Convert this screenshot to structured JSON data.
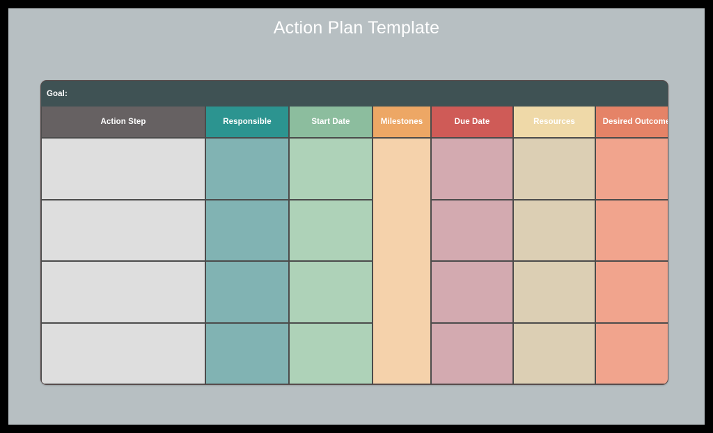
{
  "page": {
    "title": "Action Plan Template",
    "background_color": "#b7bfc2",
    "frame_color": "#000000"
  },
  "table": {
    "goal_label": "Goal:",
    "goal_bar_color": "#3f5254",
    "border_color": "#5a4c4c",
    "row_count": 4,
    "columns": [
      {
        "key": "action_step",
        "header": "Action Step",
        "header_color": "#666162",
        "body_color": "#dedede",
        "merged": false
      },
      {
        "key": "responsible",
        "header": "Responsible",
        "header_color": "#2c9490",
        "body_color": "#81b3b3",
        "merged": false
      },
      {
        "key": "start_date",
        "header": "Start Date",
        "header_color": "#8cbd9e",
        "body_color": "#aed2b8",
        "merged": false
      },
      {
        "key": "milestones",
        "header": "Milestones",
        "header_color": "#eda765",
        "body_color": "#f5d2ab",
        "merged": true
      },
      {
        "key": "due_date",
        "header": "Due Date",
        "header_color": "#cf5b57",
        "body_color": "#d3aab0",
        "merged": false
      },
      {
        "key": "resources",
        "header": "Resources",
        "header_color": "#efd9a8",
        "body_color": "#dccfb4",
        "merged": false
      },
      {
        "key": "desired_outcome",
        "header": "Desired Outcome",
        "header_color": "#e58367",
        "body_color": "#f1a48d",
        "merged": false
      }
    ],
    "rows": [
      {
        "action_step": "",
        "responsible": "",
        "start_date": "",
        "due_date": "",
        "resources": "",
        "desired_outcome": ""
      },
      {
        "action_step": "",
        "responsible": "",
        "start_date": "",
        "due_date": "",
        "resources": "",
        "desired_outcome": ""
      },
      {
        "action_step": "",
        "responsible": "",
        "start_date": "",
        "due_date": "",
        "resources": "",
        "desired_outcome": ""
      },
      {
        "action_step": "",
        "responsible": "",
        "start_date": "",
        "due_date": "",
        "resources": "",
        "desired_outcome": ""
      }
    ],
    "milestones_value": ""
  }
}
